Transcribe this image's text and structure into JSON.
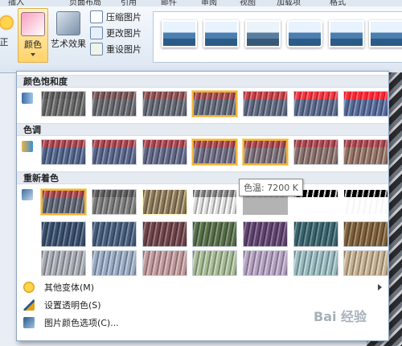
{
  "ribbon": {
    "tabs": [
      "插入",
      "页面布局",
      "引用",
      "邮件",
      "审阅",
      "视图",
      "加载项",
      "格式"
    ],
    "buttons": {
      "correct_label": "正",
      "color_label": "颜色",
      "artistic_label": "艺术效果",
      "compress_label": "压缩图片",
      "change_label": "更改图片",
      "reset_label": "重设图片"
    }
  },
  "panel": {
    "sections": [
      {
        "title": "颜色饱和度"
      },
      {
        "title": "色调"
      },
      {
        "title": "重新着色"
      }
    ],
    "menu": [
      {
        "label": "其他变体(M)",
        "has_arrow": true
      },
      {
        "label": "设置透明色(S)",
        "has_arrow": false
      },
      {
        "label": "图片颜色选项(C)...",
        "has_arrow": false
      }
    ],
    "tooltip": "色温: 7200 K"
  },
  "colors": {
    "selection": "#f2b233",
    "panel_border": "#8ea4c0"
  },
  "icons": [
    "color-icon",
    "artistic-effects-icon",
    "compress-icon",
    "change-picture-icon",
    "reset-picture-icon",
    "saturation-icon",
    "tone-icon",
    "recolor-icon",
    "variants-icon",
    "transparent-color-icon",
    "color-options-icon"
  ],
  "watermark": "Bai 经验"
}
